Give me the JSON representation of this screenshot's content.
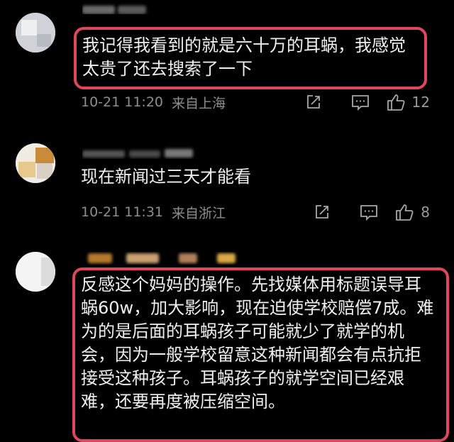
{
  "comments": [
    {
      "text": "我记得我看到的就是六十万的耳蜗，我感觉太贵了还去搜索了一下",
      "time": "10-21 11:20",
      "location": "来自上海",
      "likes": "12",
      "highlighted": true
    },
    {
      "text": "现在新闻过三天才能看",
      "time": "10-21 11:31",
      "location": "来自浙江",
      "likes": "8",
      "highlighted": false
    },
    {
      "text": "反感这个妈妈的操作。先找媒体用标题误导耳蜗60w，加大影响，现在迫使学校赔偿7成。难为的是后面的耳蜗孩子可能就少了就学的机会，因为一般学校留意这种新闻都会有点抗拒接受这种孩子。耳蜗孩子的就学空间已经艰难，还要再度被压缩空间。",
      "highlighted": true
    }
  ],
  "icons": {
    "share": "share-icon",
    "comment": "comment-icon",
    "like": "thumbs-up-icon"
  },
  "colors": {
    "background": "#000000",
    "highlight_border": "#e0475c",
    "meta_text": "#8e8e8e"
  }
}
